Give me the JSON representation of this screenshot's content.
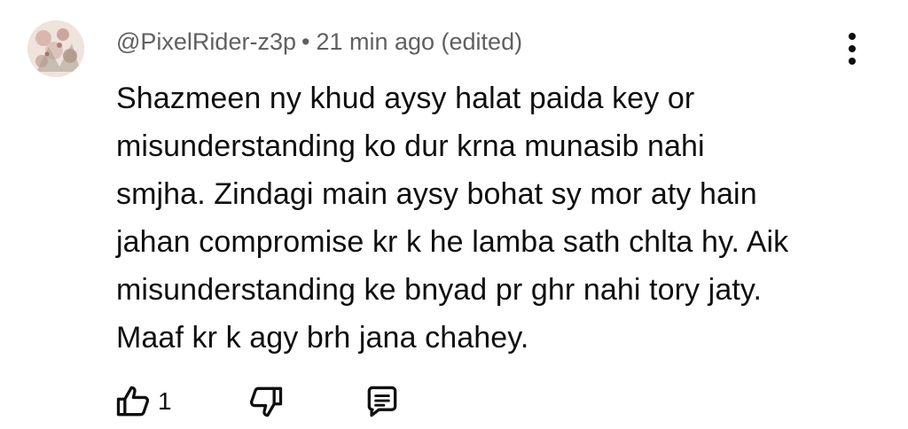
{
  "comment": {
    "author": "@PixelRider-z3p",
    "separator": "•",
    "timestamp": "21 min ago (edited)",
    "lines": [
      "Shazmeen ny khud aysy halat paida key or",
      "misunderstanding ko dur krna munasib nahi",
      "smjha. Zindagi main aysy bohat sy mor aty hain",
      "jahan compromise kr k he lamba sath chlta hy. Aik",
      "misunderstanding ke bnyad pr ghr nahi tory jaty.",
      "Maaf kr k agy brh jana chahey."
    ],
    "like_count": "1"
  },
  "icons": {
    "menu": "more-vertical-icon",
    "like": "thumb-up-icon",
    "dislike": "thumb-down-icon",
    "reply": "comment-reply-icon"
  },
  "colors": {
    "text": "#0f0f0f",
    "meta_text": "#606060"
  }
}
